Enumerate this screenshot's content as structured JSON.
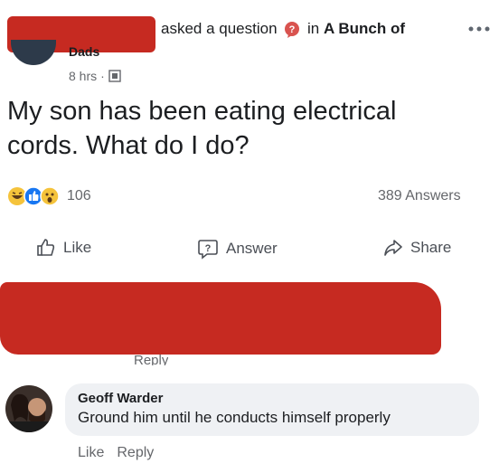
{
  "header": {
    "asked_text": "asked a question",
    "group_prefix": "in",
    "group_name": "A Bunch of",
    "group_name_tail": "Dads",
    "time": "8 hrs",
    "separator": "·"
  },
  "post": {
    "question_line1": "My son has been eating electrical",
    "question_line2": "cords. What do I do?"
  },
  "stats": {
    "reactions_count": "106",
    "answers_count": "389 Answers"
  },
  "actions": {
    "like": "Like",
    "answer": "Answer",
    "share": "Share"
  },
  "redacted_comment": {
    "reply": "Reply"
  },
  "comment": {
    "author": "Geoff Warder",
    "text": "Ground him until he conducts himself properly",
    "like": "Like",
    "reply": "Reply"
  },
  "colors": {
    "redaction": "#c62a21",
    "question_icon": "#d9534f",
    "link_gray": "#65676b"
  },
  "icons": [
    "more-icon",
    "question-badge-icon",
    "globe-icon",
    "haha-icon",
    "wow-icon",
    "like-icon",
    "answer-icon",
    "share-icon"
  ]
}
